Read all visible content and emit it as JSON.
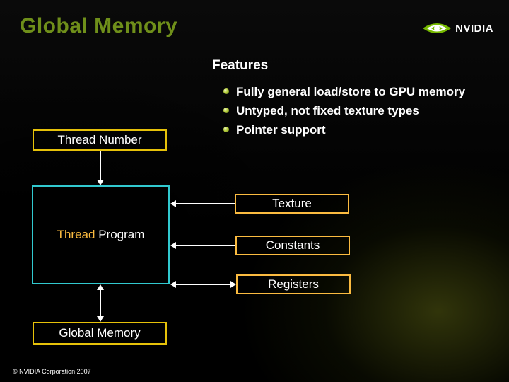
{
  "title": "Global Memory",
  "logo": {
    "text": "NVIDIA"
  },
  "features": {
    "heading": "Features",
    "items": [
      "Fully general load/store to GPU memory",
      "Untyped, not fixed texture types",
      "Pointer support"
    ]
  },
  "diagram": {
    "thread_number": "Thread Number",
    "thread_program_accent": "Thread",
    "thread_program_rest": " Program",
    "texture": "Texture",
    "constants": "Constants",
    "registers": "Registers",
    "global_memory": "Global Memory"
  },
  "footer": "© NVIDIA Corporation 2007"
}
